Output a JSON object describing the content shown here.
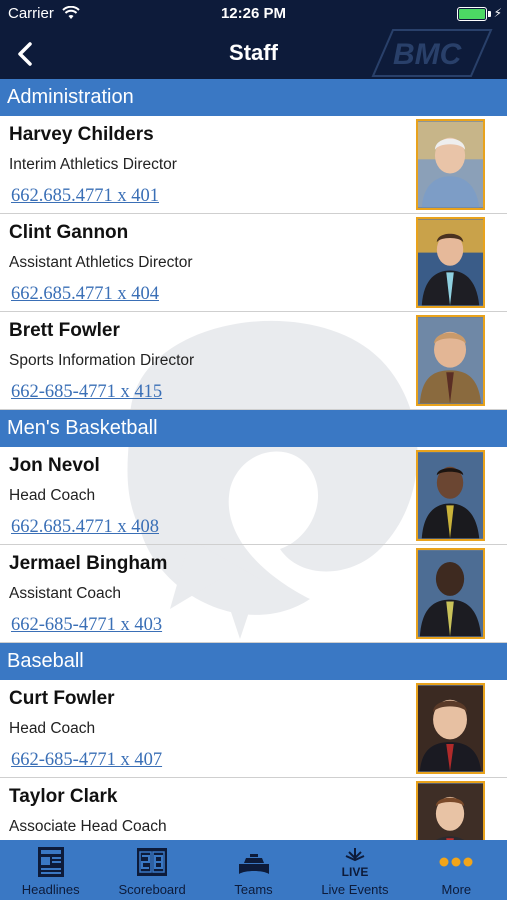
{
  "status_bar": {
    "carrier": "Carrier",
    "time": "12:26 PM"
  },
  "nav": {
    "title": "Staff",
    "logo_text": "BMC"
  },
  "sections": [
    {
      "header": "Administration",
      "rows": [
        {
          "name": "Harvey Childers",
          "role": "Interim Athletics Director",
          "phone": "662.685.4771 x 401"
        },
        {
          "name": "Clint Gannon",
          "role": "Assistant Athletics Director",
          "phone": "662.685.4771 x 404"
        },
        {
          "name": "Brett Fowler",
          "role": "Sports Information Director",
          "phone": "662-685-4771 x 415"
        }
      ]
    },
    {
      "header": "Men's Basketball",
      "rows": [
        {
          "name": "Jon Nevol",
          "role": "Head Coach",
          "phone": "662.685.4771 x 408"
        },
        {
          "name": "Jermael Bingham",
          "role": "Assistant Coach",
          "phone": "662-685-4771 x 403"
        }
      ]
    },
    {
      "header": "Baseball",
      "rows": [
        {
          "name": "Curt Fowler",
          "role": "Head Coach",
          "phone": "662-685-4771 x 407"
        },
        {
          "name": "Taylor Clark",
          "role": "Associate Head Coach",
          "phone": ""
        }
      ]
    }
  ],
  "tabs": [
    {
      "label": "Headlines",
      "icon": "newspaper-icon"
    },
    {
      "label": "Scoreboard",
      "icon": "scoreboard-icon"
    },
    {
      "label": "Teams",
      "icon": "stadium-icon"
    },
    {
      "label": "Live Events",
      "icon": "live-broadcast-icon",
      "icon_text": "LIVE"
    },
    {
      "label": "More",
      "icon": "more-dots-icon"
    }
  ],
  "colors": {
    "navy": "#0d1b3a",
    "accent_blue": "#3a78c4",
    "link": "#3a6fb6",
    "photo_border": "#e8a21c",
    "more_dots": "#f2a51a"
  }
}
